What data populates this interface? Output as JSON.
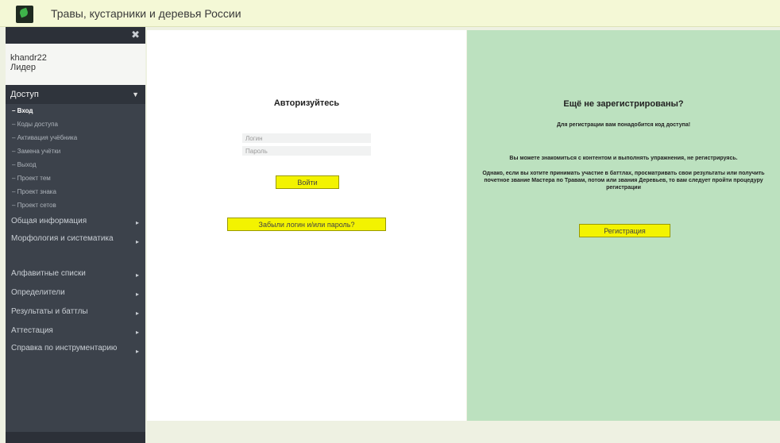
{
  "header": {
    "site_title": "Травы, кустарники и деревья России"
  },
  "sidebar": {
    "close_glyph": "✖",
    "user": {
      "name": "khandr22",
      "role": "Лидер"
    },
    "access_section": {
      "label": "Доступ",
      "items": [
        {
          "label": "– Вход",
          "active": true
        },
        {
          "label": "– Коды доступа",
          "active": false
        },
        {
          "label": "– Активация учёбника",
          "active": false
        },
        {
          "label": "– Замена учётки",
          "active": false
        },
        {
          "label": "– Выход",
          "active": false
        },
        {
          "label": "– Проект тем",
          "active": false
        },
        {
          "label": "– Проект знака",
          "active": false
        },
        {
          "label": "– Проект сетов",
          "active": false
        }
      ]
    },
    "nav_items": [
      {
        "label": "Общая информация",
        "arrow": "▸"
      },
      {
        "label": "Морфология и систематика",
        "arrow": "▸"
      },
      {
        "label": "Алфавитные списки",
        "arrow": "▸"
      },
      {
        "label": "Определители",
        "arrow": "▸"
      },
      {
        "label": "Результаты и баттлы",
        "arrow": "▸"
      },
      {
        "label": "Аттестация",
        "arrow": "▸"
      },
      {
        "label": "Справка по инструментарию",
        "arrow": "▸"
      }
    ]
  },
  "login": {
    "title": "Авторизуйтесь",
    "login_placeholder": "Логин",
    "password_placeholder": "Пароль",
    "submit_label": "Войти",
    "forgot_label": "Забыли логин и/или пароль?"
  },
  "register": {
    "title": "Ещё не зарегистрированы?",
    "note": "Для регистрации вам понадобится код доступа!",
    "paragraph1": "Вы можете знакомиться с контентом и выполнять упражнения, не регистрируясь.",
    "paragraph2": "Однако, если вы хотите принимать участие в баттлах, просматривать свои результаты или получить почетное звание Мастера по Травам, потом или звания Деревьев, то вам следует пройти процедуру регистрации",
    "button_label": "Регистрация"
  },
  "colors": {
    "header_bg": "#f4f8d6",
    "sidebar_bg": "#3c424b",
    "register_bg": "#bce1bf",
    "button_bg": "#f3f300"
  }
}
